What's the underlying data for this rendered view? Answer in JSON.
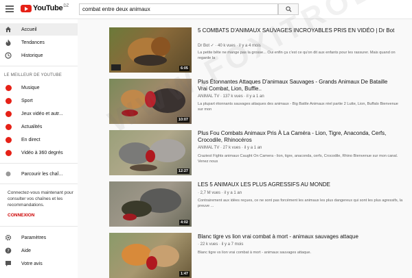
{
  "header": {
    "logo_text": "YouTube",
    "logo_country": "DZ",
    "search_value": "combat entre deux animaux"
  },
  "sidebar": {
    "main_items": [
      {
        "label": "Accueil",
        "icon": "home-icon"
      },
      {
        "label": "Tendances",
        "icon": "fire-icon"
      },
      {
        "label": "Historique",
        "icon": "history-icon"
      }
    ],
    "best_title": "LE MEILLEUR DE YOUTUBE",
    "best_items": [
      {
        "label": "Musique"
      },
      {
        "label": "Sport"
      },
      {
        "label": "Jeux vidéo et autr..."
      },
      {
        "label": "Actualités"
      },
      {
        "label": "En direct"
      },
      {
        "label": "Vidéo à 360 degrés"
      }
    ],
    "browse_channels": "Parcourir les chaî...",
    "promo_text": "Connectez-vous maintenant pour consulter vos chaînes et les recommandations.",
    "signin_label": "CONNEXION",
    "bottom_items": [
      {
        "label": "Paramètres",
        "icon": "gear-icon"
      },
      {
        "label": "Aide",
        "icon": "help-icon"
      },
      {
        "label": "Votre avis",
        "icon": "feedback-icon"
      }
    ]
  },
  "results": [
    {
      "title": "5 COMBATS D'ANIMAUX SAUVAGES INCROYABLES PRIS EN VIDÉO | Dr Bot",
      "meta": "Dr Bot ✓ · 40 k vues · il y a 4 mois",
      "desc": "La petite bête ne mange pas la grosse... Oui enfin ça c'est ce qu'on dit aux enfants pour les rassurer. Mais quand on regarde la",
      "duration": "6:05"
    },
    {
      "title": "Plus Étonnantes Attaques D'animaux Sauvages - Grands Animaux De Bataille Vrai Combat, Lion, Buffle..",
      "meta": "ANIMAL TV · 137 k vues · il y a 1 an",
      "desc": "La plupart étonnants sauvages attaques des animaux - Big Battle Animaux réel partie 2 Lutte, Lion, Buffalo Bienvenue sur mon",
      "duration": "10:07"
    },
    {
      "title": "Plus Fou Combats Animaux Pris À La Caméra - Lion, Tigre, Anaconda, Cerfs, Crocodile, Rhinocéros",
      "meta": "ANIMAL TV · 27 k vues · il y a 1 an",
      "desc": "Craziest Fights animaux Caught On Camera - lion, tigre, anaconda, cerfs, Crocodile, Rhino Bienvenue sur mon canal. Venez nous",
      "duration": "12:27"
    },
    {
      "title": "LES 5 ANIMAUX LES PLUS AGRESSIFS AU MONDE",
      "meta": "· 2,7 M vues · il y a 1 an",
      "desc": "Contrairement aux idées reçues, ce ne sont pas forcément les animaux les plus dangereux qui sont les plus agressifs, la preuve ...",
      "duration": "4:02"
    },
    {
      "title": "Blanc tigre vs lion vrai combat à mort - animaux sauvages attaque",
      "meta": "· 22 k vues · il y a 7 mois",
      "desc": "Blanc tigre vs lion vrai combat à mort - animaux sauvages attaque.",
      "duration": "1:47"
    }
  ],
  "watermark": "WWW.FOXITRODZ.COM"
}
